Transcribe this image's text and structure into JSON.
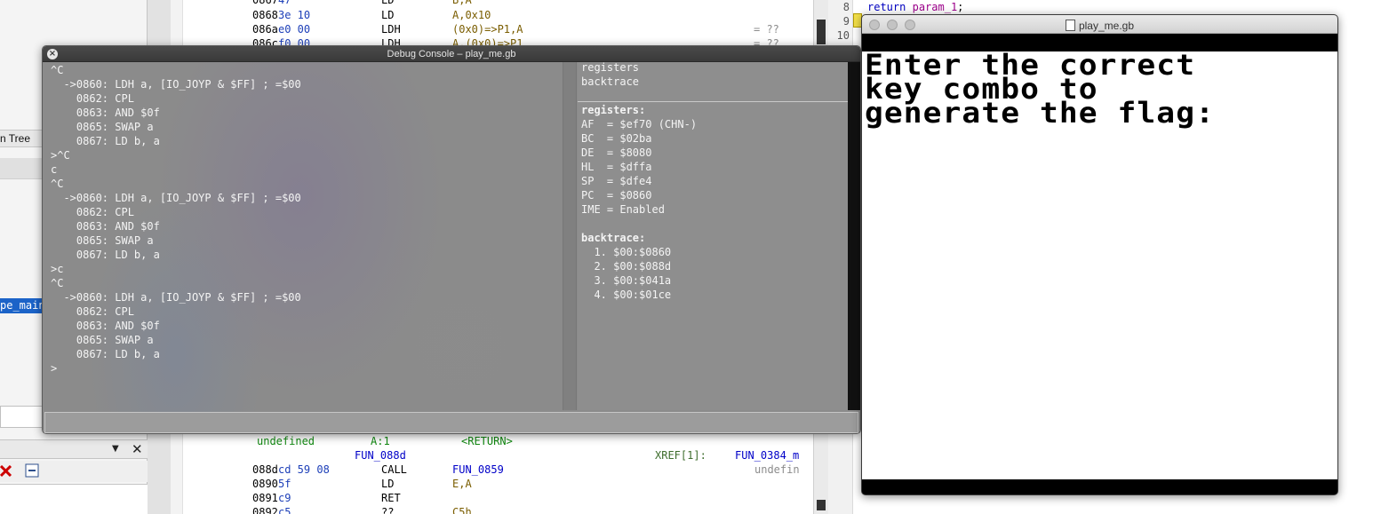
{
  "left_panel": {
    "tree_tab_label": "n Tree",
    "selected_item": "pe_main",
    "toolbar": {
      "dropdown_icon": "▼",
      "close_icon": "✕"
    }
  },
  "listing": {
    "rows": [
      {
        "addr": "0867",
        "bytes": "47",
        "mnem": "LD",
        "operands": "B,A",
        "comment": ""
      },
      {
        "addr": "0868",
        "bytes": "3e 10",
        "mnem": "LD",
        "operands": "A,0x10",
        "comment": ""
      },
      {
        "addr": "086a",
        "bytes": "e0 00",
        "mnem": "LDH",
        "operands": "(0x0)=>P1,A",
        "comment": "= ??"
      },
      {
        "addr": "086c",
        "bytes": "f0 00",
        "mnem": "LDH",
        "operands": "A,(0x0)=>P1",
        "comment": "= ??"
      }
    ],
    "func_header": {
      "ret_type": "undefined",
      "storage": "A:1",
      "ret": "<RETURN>",
      "label": "FUN_088d",
      "xref": "XREF[1]:",
      "xref_target": "FUN_0384_m"
    },
    "lower_rows": [
      {
        "addr": "088d",
        "bytes": "cd 59 08",
        "mnem": "CALL",
        "operands": "FUN_0859",
        "comment": "undefin"
      },
      {
        "addr": "0890",
        "bytes": "5f",
        "mnem": "LD",
        "operands": "E,A",
        "comment": ""
      },
      {
        "addr": "0891",
        "bytes": "c9",
        "mnem": "RET",
        "operands": "",
        "comment": ""
      },
      {
        "addr": "0892",
        "bytes": "c5",
        "mnem": "??",
        "operands": "C5h",
        "comment": ""
      }
    ]
  },
  "decompiler": {
    "line_numbers": [
      "8",
      "9",
      "10"
    ],
    "return_kw": "return",
    "return_var": "param_1",
    "return_end": ";"
  },
  "debug_console": {
    "title": "Debug Console – play_me.gb",
    "close_icon": "×",
    "console_lines": [
      "^C",
      "  ->0860: LDH a, [IO_JOYP & $FF] ; =$00",
      "    0862: CPL",
      "    0863: AND $0f",
      "    0865: SWAP a",
      "    0867: LD b, a",
      ">^C",
      "c",
      "^C",
      "  ->0860: LDH a, [IO_JOYP & $FF] ; =$00",
      "    0862: CPL",
      "    0863: AND $0f",
      "    0865: SWAP a",
      "    0867: LD b, a",
      ">c",
      "^C",
      "  ->0860: LDH a, [IO_JOYP & $FF] ; =$00",
      "    0862: CPL",
      "    0863: AND $0f",
      "    0865: SWAP a",
      "    0867: LD b, a",
      ">"
    ],
    "tabs": [
      "registers",
      "backtrace"
    ],
    "info_lines": [
      "registers:",
      "AF  = $ef70 (CHN-)",
      "BC  = $02ba",
      "DE  = $8080",
      "HL  = $dffa",
      "SP  = $dfe4",
      "PC  = $0860",
      "IME = Enabled",
      "",
      "backtrace:",
      "  1. $00:$0860",
      "  2. $00:$088d",
      "  3. $00:$041a",
      "  4. $00:$01ce"
    ]
  },
  "game_window": {
    "title": "play_me.gb",
    "screen_lines": [
      "Enter the correct",
      "key combo to",
      "generate the flag:"
    ]
  }
}
